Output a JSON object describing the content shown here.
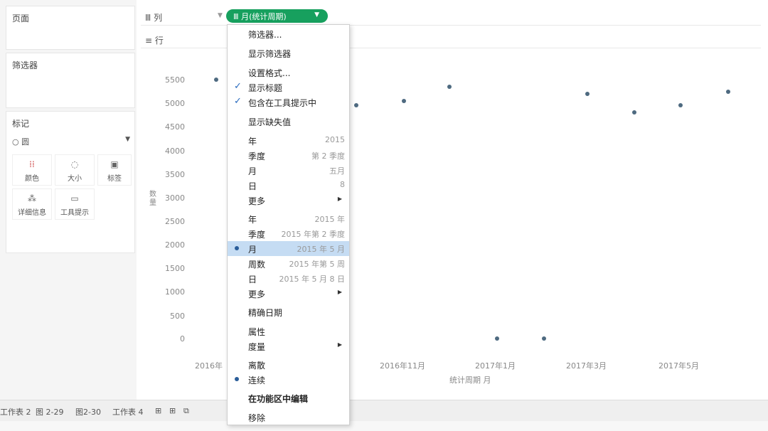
{
  "left": {
    "pages_title": "页面",
    "filters_title": "筛选器",
    "marks_title": "标记",
    "marks_type": "○ 圆",
    "mark_buttons": [
      "颜色",
      "大小",
      "标签",
      "详细信息",
      "工具提示"
    ]
  },
  "shelves": {
    "columns_label": "Ⅲ 列",
    "rows_label": "≡ 行",
    "pill_label": "Ⅲ 月(统计周期)"
  },
  "chart": {
    "yticks": [
      "5500",
      "5000",
      "4500",
      "4000",
      "3500",
      "3000",
      "2500",
      "2000",
      "1500",
      "1000",
      "500",
      "0"
    ],
    "xticks": [
      "2016年",
      "2016年11月",
      "2017年1月",
      "2017年3月",
      "2017年5月"
    ],
    "ylabel": "数量",
    "xlabel": "统计周期 月"
  },
  "chart_data": {
    "type": "scatter",
    "ylim": [
      0,
      5500
    ],
    "points": [
      5500,
      4950,
      5050,
      5350,
      0,
      0,
      5200,
      4800,
      4950,
      5250
    ]
  },
  "menu": {
    "items": [
      {
        "label": "筛选器...",
        "value": ""
      },
      {
        "label": "显示筛选器",
        "value": ""
      },
      {
        "label": "设置格式...",
        "value": ""
      },
      {
        "label": "显示标题",
        "value": ""
      },
      {
        "label": "包含在工具提示中",
        "value": ""
      },
      {
        "label": "显示缺失值",
        "value": ""
      },
      {
        "label": "年",
        "value": "2015"
      },
      {
        "label": "季度",
        "value": "第 2 季度"
      },
      {
        "label": "月",
        "value": "五月"
      },
      {
        "label": "日",
        "value": "8"
      },
      {
        "label": "更多",
        "value": ""
      },
      {
        "label": "年",
        "value": "2015 年"
      },
      {
        "label": "季度",
        "value": "2015 年第 2 季度"
      },
      {
        "label": "月",
        "value": "2015 年 5 月"
      },
      {
        "label": "周数",
        "value": "2015 年第 5 周"
      },
      {
        "label": "日",
        "value": "2015 年 5 月 8 日"
      },
      {
        "label": "更多",
        "value": ""
      },
      {
        "label": "精确日期",
        "value": ""
      },
      {
        "label": "属性",
        "value": ""
      },
      {
        "label": "度量",
        "value": ""
      },
      {
        "label": "离散",
        "value": ""
      },
      {
        "label": "连续",
        "value": ""
      },
      {
        "label": "在功能区中编辑",
        "value": ""
      },
      {
        "label": "移除",
        "value": ""
      }
    ]
  },
  "tabs": [
    "工作表 2",
    "图 2-29",
    "图2-30",
    "工作表 4",
    "⊞",
    "⊞",
    "⧉"
  ]
}
